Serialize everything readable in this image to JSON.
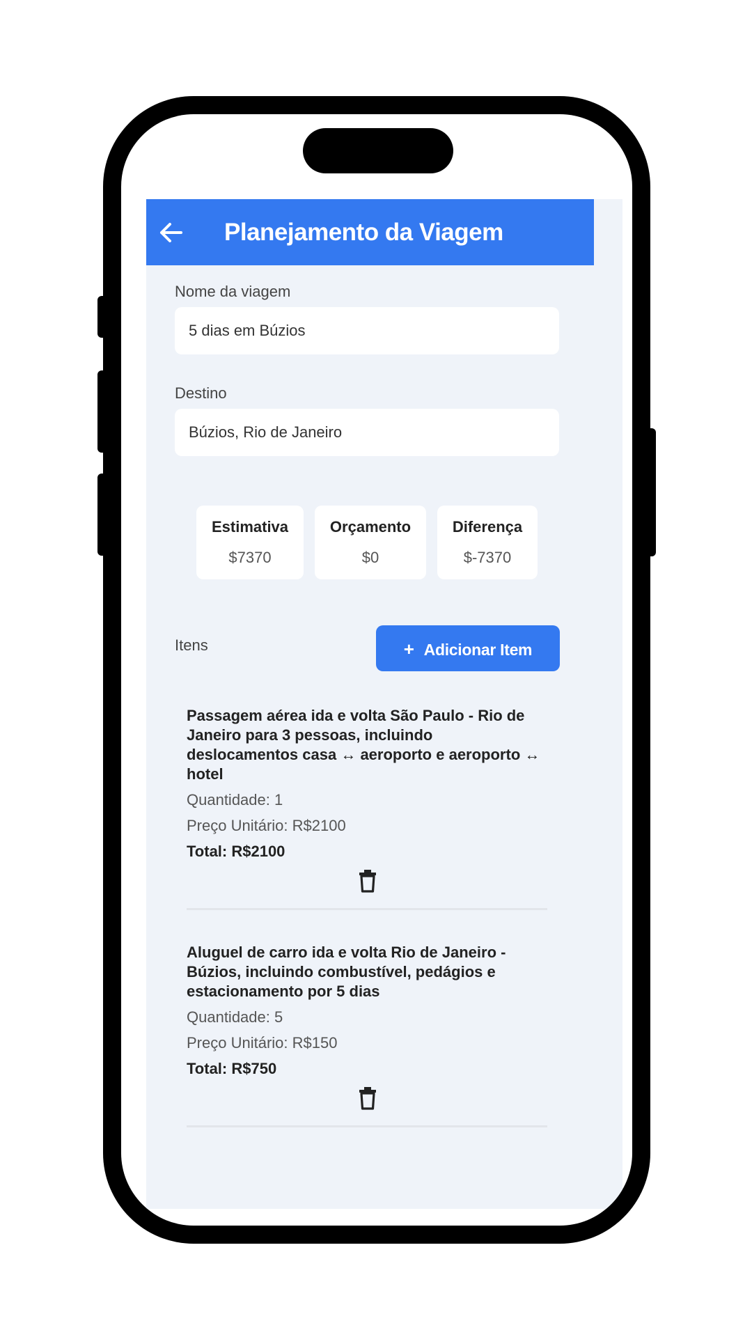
{
  "header": {
    "title": "Planejamento da Viagem",
    "back_icon": "arrow-left-icon"
  },
  "form": {
    "trip_name_label": "Nome da viagem",
    "trip_name_value": "5 dias em Búzios",
    "destination_label": "Destino",
    "destination_value": "Búzios, Rio de Janeiro"
  },
  "summary": {
    "estimate_label": "Estimativa",
    "estimate_value": "$7370",
    "budget_label": "Orçamento",
    "budget_value": "$0",
    "difference_label": "Diferença",
    "difference_value": "$-7370"
  },
  "items_section": {
    "label": "Itens",
    "add_button_icon": "+",
    "add_button_label": "Adicionar Item"
  },
  "items": [
    {
      "title": "Passagem aérea ida e volta São Paulo - Rio de Janeiro para 3 pessoas, incluindo deslocamentos casa ↔ aeroporto e aeroporto ↔ hotel",
      "quantity": "Quantidade: 1",
      "unit_price": "Preço Unitário: R$2100",
      "total": "Total: R$2100"
    },
    {
      "title": "Aluguel de carro ida e volta Rio de Janeiro - Búzios, incluindo combustível, pedágios e estacionamento por 5 dias",
      "quantity": "Quantidade: 5",
      "unit_price": "Preço Unitário: R$150",
      "total": "Total: R$750"
    }
  ],
  "colors": {
    "accent": "#3479f0",
    "background": "#eff3f9"
  }
}
